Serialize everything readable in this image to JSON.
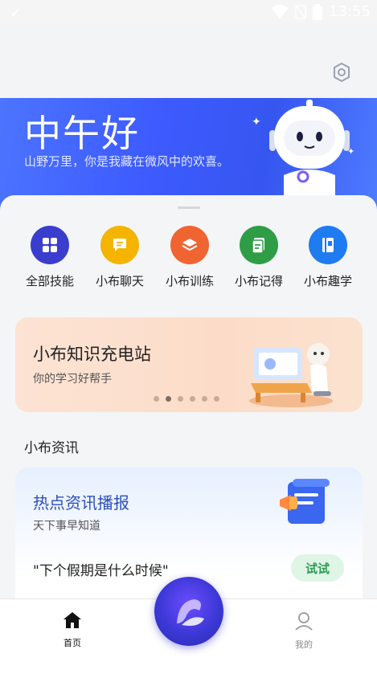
{
  "status_bar": {
    "time": "13:55"
  },
  "banner": {
    "greeting": "中午好",
    "subtitle": "山野万里，你是我藏在微风中的欢喜。"
  },
  "grid": [
    {
      "label": "全部技能",
      "color": "#3a3dce",
      "icon": "apps-icon"
    },
    {
      "label": "小布聊天",
      "color": "#f4b400",
      "icon": "chat-icon"
    },
    {
      "label": "小布训练",
      "color": "#f06432",
      "icon": "layers-icon"
    },
    {
      "label": "小布记得",
      "color": "#2e9d46",
      "icon": "note-icon"
    },
    {
      "label": "小布趣学",
      "color": "#1e7cf0",
      "icon": "book-icon"
    }
  ],
  "knowledge_card": {
    "title": "小布知识充电站",
    "subtitle": "你的学习好帮手",
    "carousel": {
      "total": 6,
      "active": 2
    }
  },
  "news_section": {
    "title": "小布资讯"
  },
  "news_card": {
    "title": "热点资讯播报",
    "subtitle": "天下事早知道",
    "query": "\"下个假期是什么时候\"",
    "try_label": "试试"
  },
  "bottom_nav": {
    "home_label": "首页",
    "mine_label": "我的"
  }
}
